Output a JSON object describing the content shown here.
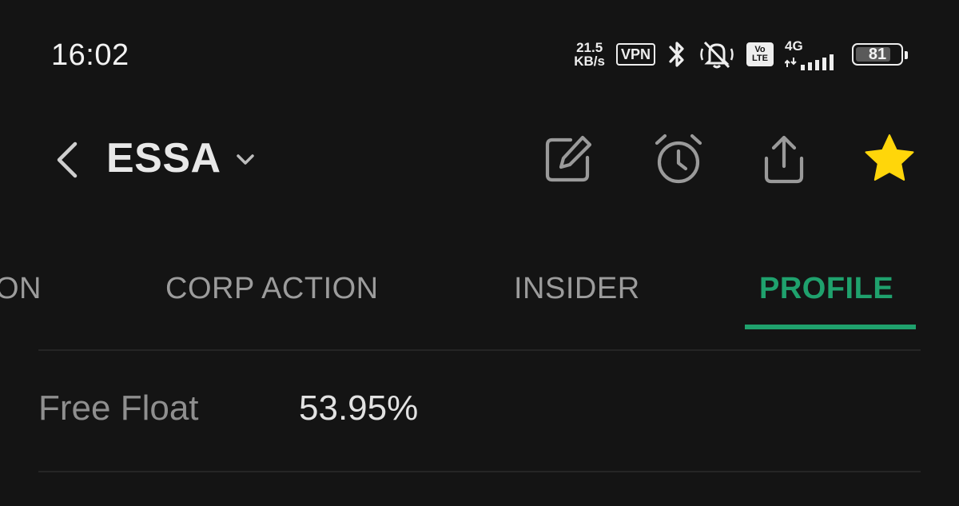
{
  "status_bar": {
    "time": "16:02",
    "net_speed_value": "21.5",
    "net_speed_unit": "KB/s",
    "vpn": "VPN",
    "volte_top": "Vo",
    "volte_bottom": "LTE",
    "network_type": "4G",
    "battery_level": "81",
    "battery_fraction": 0.81
  },
  "header": {
    "ticker": "ESSA",
    "favorite_color": "#FFD60A"
  },
  "tabs": [
    {
      "label": "ON"
    },
    {
      "label": "CORP ACTION"
    },
    {
      "label": "INSIDER"
    },
    {
      "label": "PROFILE",
      "active": true
    }
  ],
  "profile": {
    "free_float_label": "Free Float",
    "free_float_value": "53.95%"
  },
  "colors": {
    "background": "#141414",
    "accent_green": "#1FA16D",
    "tab_inactive": "#9C9C9C"
  }
}
